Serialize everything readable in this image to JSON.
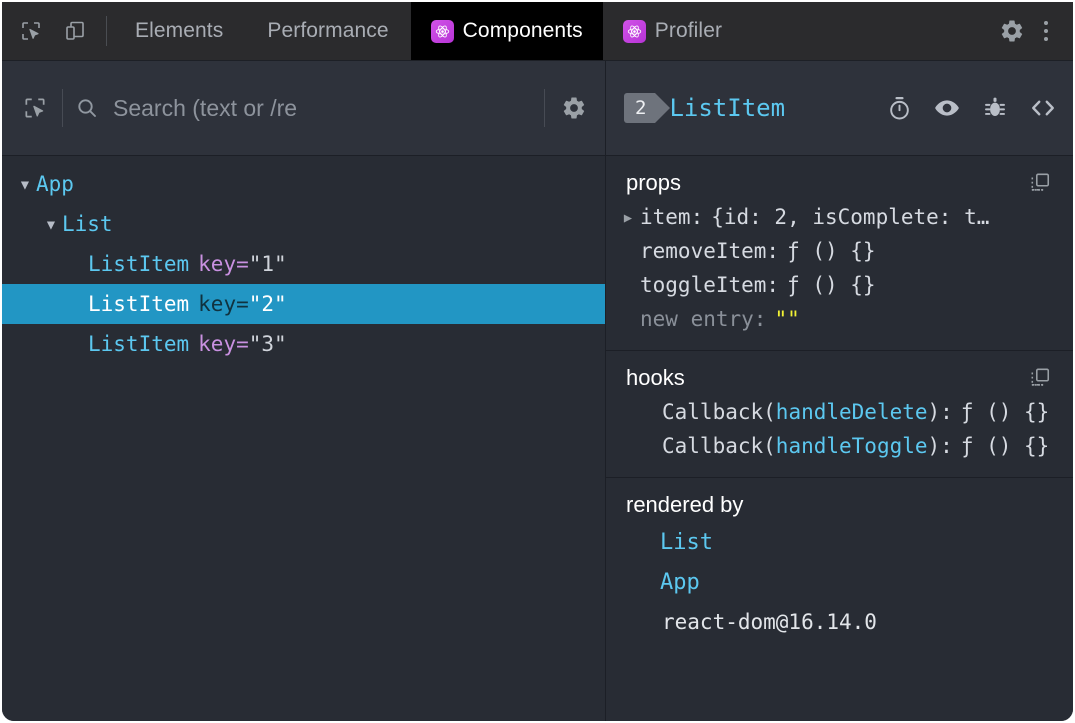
{
  "colors": {
    "panel_bg": "#282c34",
    "bar_bg": "#2e323b",
    "tabbar_bg": "#2b2b2d",
    "active_tab_bg": "#000000",
    "selection": "#2296c4",
    "component_cyan": "#5cc8f0",
    "prop_purple": "#c991e1",
    "string_yellow": "#f2f234",
    "react_badge": "#c13ad8"
  },
  "tabbar": {
    "icons": [
      {
        "name": "inspect-element-icon",
        "label": "Inspect element"
      },
      {
        "name": "device-toolbar-icon",
        "label": "Toggle device toolbar"
      }
    ],
    "tabs": [
      {
        "label": "Elements",
        "active": false,
        "has_react_icon": false
      },
      {
        "label": "Performance",
        "active": false,
        "has_react_icon": false
      },
      {
        "label": "Components",
        "active": true,
        "has_react_icon": true
      },
      {
        "label": "Profiler",
        "active": false,
        "has_react_icon": true
      }
    ],
    "settings_label": "Settings",
    "more_label": "More options"
  },
  "search": {
    "placeholder": "Search (text or /re",
    "value": "",
    "inspect_label": "Select an element in the page to inspect it",
    "settings_label": "View settings"
  },
  "tree": {
    "rows": [
      {
        "name": "App",
        "indent": 0,
        "arrow": "down",
        "key": "",
        "selected": false
      },
      {
        "name": "List",
        "indent": 1,
        "arrow": "down",
        "key": "",
        "selected": false
      },
      {
        "name": "ListItem",
        "indent": 2,
        "arrow": "none",
        "key": "\"1\"",
        "selected": false
      },
      {
        "name": "ListItem",
        "indent": 2,
        "arrow": "none",
        "key": "\"2\"",
        "selected": true
      },
      {
        "name": "ListItem",
        "indent": 2,
        "arrow": "none",
        "key": "\"3\"",
        "selected": false
      }
    ],
    "key_label": "key="
  },
  "inspector": {
    "badge": "2",
    "title": "ListItem",
    "actions": [
      {
        "name": "stopwatch-icon",
        "label": "Highlight updates"
      },
      {
        "name": "eye-icon",
        "label": "Inspect the matching DOM element"
      },
      {
        "name": "bug-icon",
        "label": "Log this component data to the console"
      },
      {
        "name": "code-icon",
        "label": "View source for this element"
      }
    ],
    "props": {
      "title": "props",
      "copy_label": "Copy props to clipboard",
      "rows": [
        {
          "name": "item:",
          "value": "{id: 2, isComplete: t…",
          "expandable": true,
          "kind": "object"
        },
        {
          "name": "removeItem:",
          "value": "ƒ () {}",
          "expandable": false,
          "kind": "function"
        },
        {
          "name": "toggleItem:",
          "value": "ƒ () {}",
          "expandable": false,
          "kind": "function"
        },
        {
          "name": "new entry:",
          "value": "\"\"",
          "expandable": false,
          "kind": "new-entry"
        }
      ]
    },
    "hooks": {
      "title": "hooks",
      "copy_label": "Copy hooks to clipboard",
      "rows": [
        {
          "prefix": "Callback(",
          "fn": "handleDelete",
          "suffix": "):",
          "value": "ƒ () {}"
        },
        {
          "prefix": "Callback(",
          "fn": "handleToggle",
          "suffix": "):",
          "value": "ƒ () {}"
        }
      ]
    },
    "rendered_by": {
      "title": "rendered by",
      "owners": [
        "List",
        "App"
      ],
      "renderer": "react-dom@16.14.0"
    }
  }
}
